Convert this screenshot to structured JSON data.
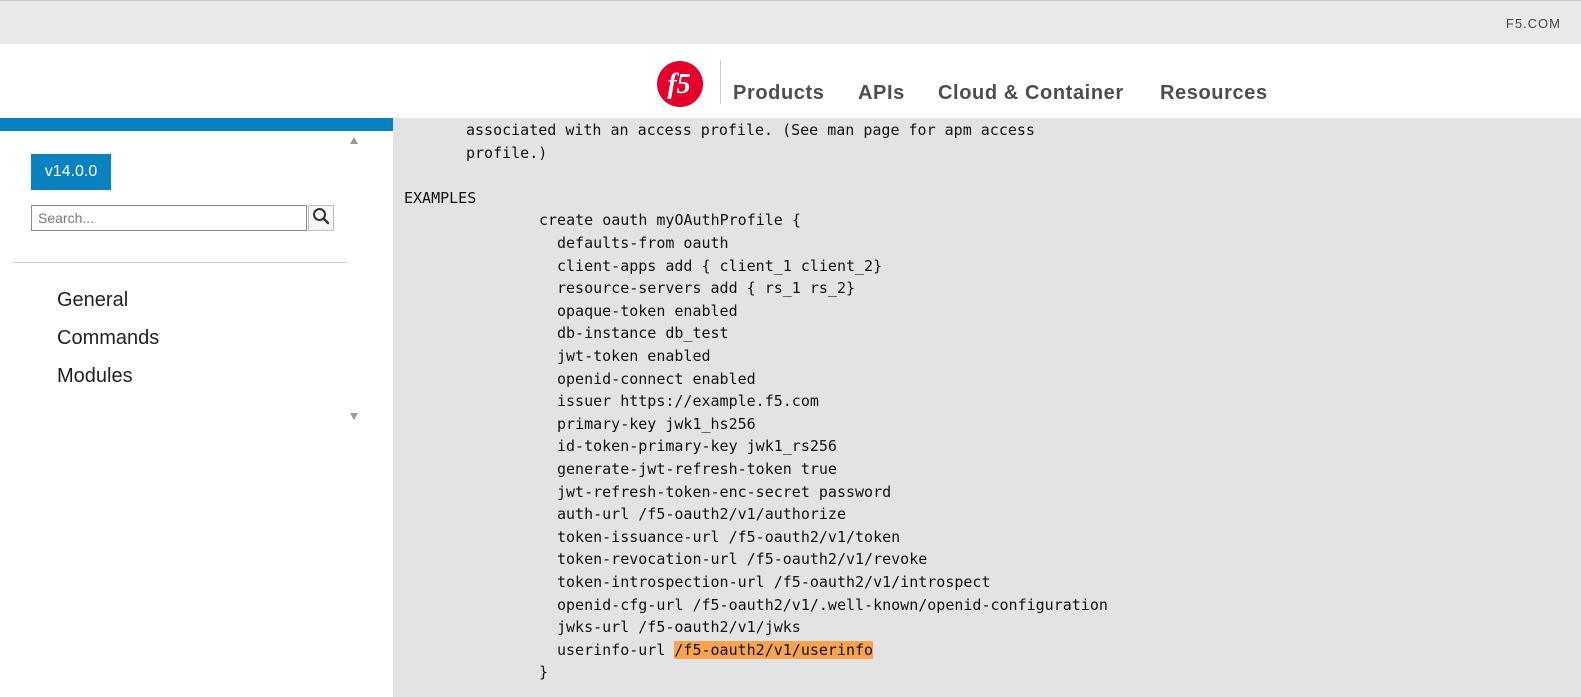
{
  "utility": {
    "link": "F5.COM"
  },
  "header": {
    "logo_alt": "f5",
    "nav": [
      {
        "label": "Products"
      },
      {
        "label": "APIs"
      },
      {
        "label": "Cloud & Container"
      },
      {
        "label": "Resources"
      }
    ]
  },
  "sidebar": {
    "version": "v14.0.0",
    "search_placeholder": "Search...",
    "items": [
      {
        "label": "General"
      },
      {
        "label": "Commands"
      },
      {
        "label": "Modules"
      }
    ]
  },
  "content": {
    "lines": [
      {
        "text": "associated with an access profile. (See man page for apm access",
        "indent": 73
      },
      {
        "text": "profile.)",
        "indent": 73
      },
      {
        "text": "",
        "indent": 0
      },
      {
        "text": "EXAMPLES",
        "indent": 11
      },
      {
        "text": "create oauth myOAuthProfile {",
        "indent": 146
      },
      {
        "text": "defaults-from oauth",
        "indent": 164
      },
      {
        "text": "client-apps add { client_1 client_2}",
        "indent": 164
      },
      {
        "text": "resource-servers add { rs_1 rs_2}",
        "indent": 164
      },
      {
        "text": "opaque-token enabled",
        "indent": 164
      },
      {
        "text": "db-instance db_test",
        "indent": 164
      },
      {
        "text": "jwt-token enabled",
        "indent": 164
      },
      {
        "text": "openid-connect enabled",
        "indent": 164
      },
      {
        "text": "issuer https://example.f5.com",
        "indent": 164
      },
      {
        "text": "primary-key jwk1_hs256",
        "indent": 164
      },
      {
        "text": "id-token-primary-key jwk1_rs256",
        "indent": 164
      },
      {
        "text": "generate-jwt-refresh-token true",
        "indent": 164
      },
      {
        "text": "jwt-refresh-token-enc-secret password",
        "indent": 164
      },
      {
        "text": "auth-url /f5-oauth2/v1/authorize",
        "indent": 164
      },
      {
        "text": "token-issuance-url /f5-oauth2/v1/token",
        "indent": 164
      },
      {
        "text": "token-revocation-url /f5-oauth2/v1/revoke",
        "indent": 164
      },
      {
        "text": "token-introspection-url /f5-oauth2/v1/introspect",
        "indent": 164
      },
      {
        "text": "openid-cfg-url /f5-oauth2/v1/.well-known/openid-configuration",
        "indent": 164
      },
      {
        "text": "jwks-url /f5-oauth2/v1/jwks",
        "indent": 164
      },
      {
        "text": "userinfo-url ",
        "indent": 164,
        "highlight": "/f5-oauth2/v1/userinfo"
      },
      {
        "text": "}",
        "indent": 146
      }
    ]
  },
  "colors": {
    "accent": "#0b82c0",
    "highlight": "#f7a34f",
    "content_bg": "#e3e3e3",
    "logo_red": "#e4002b"
  }
}
